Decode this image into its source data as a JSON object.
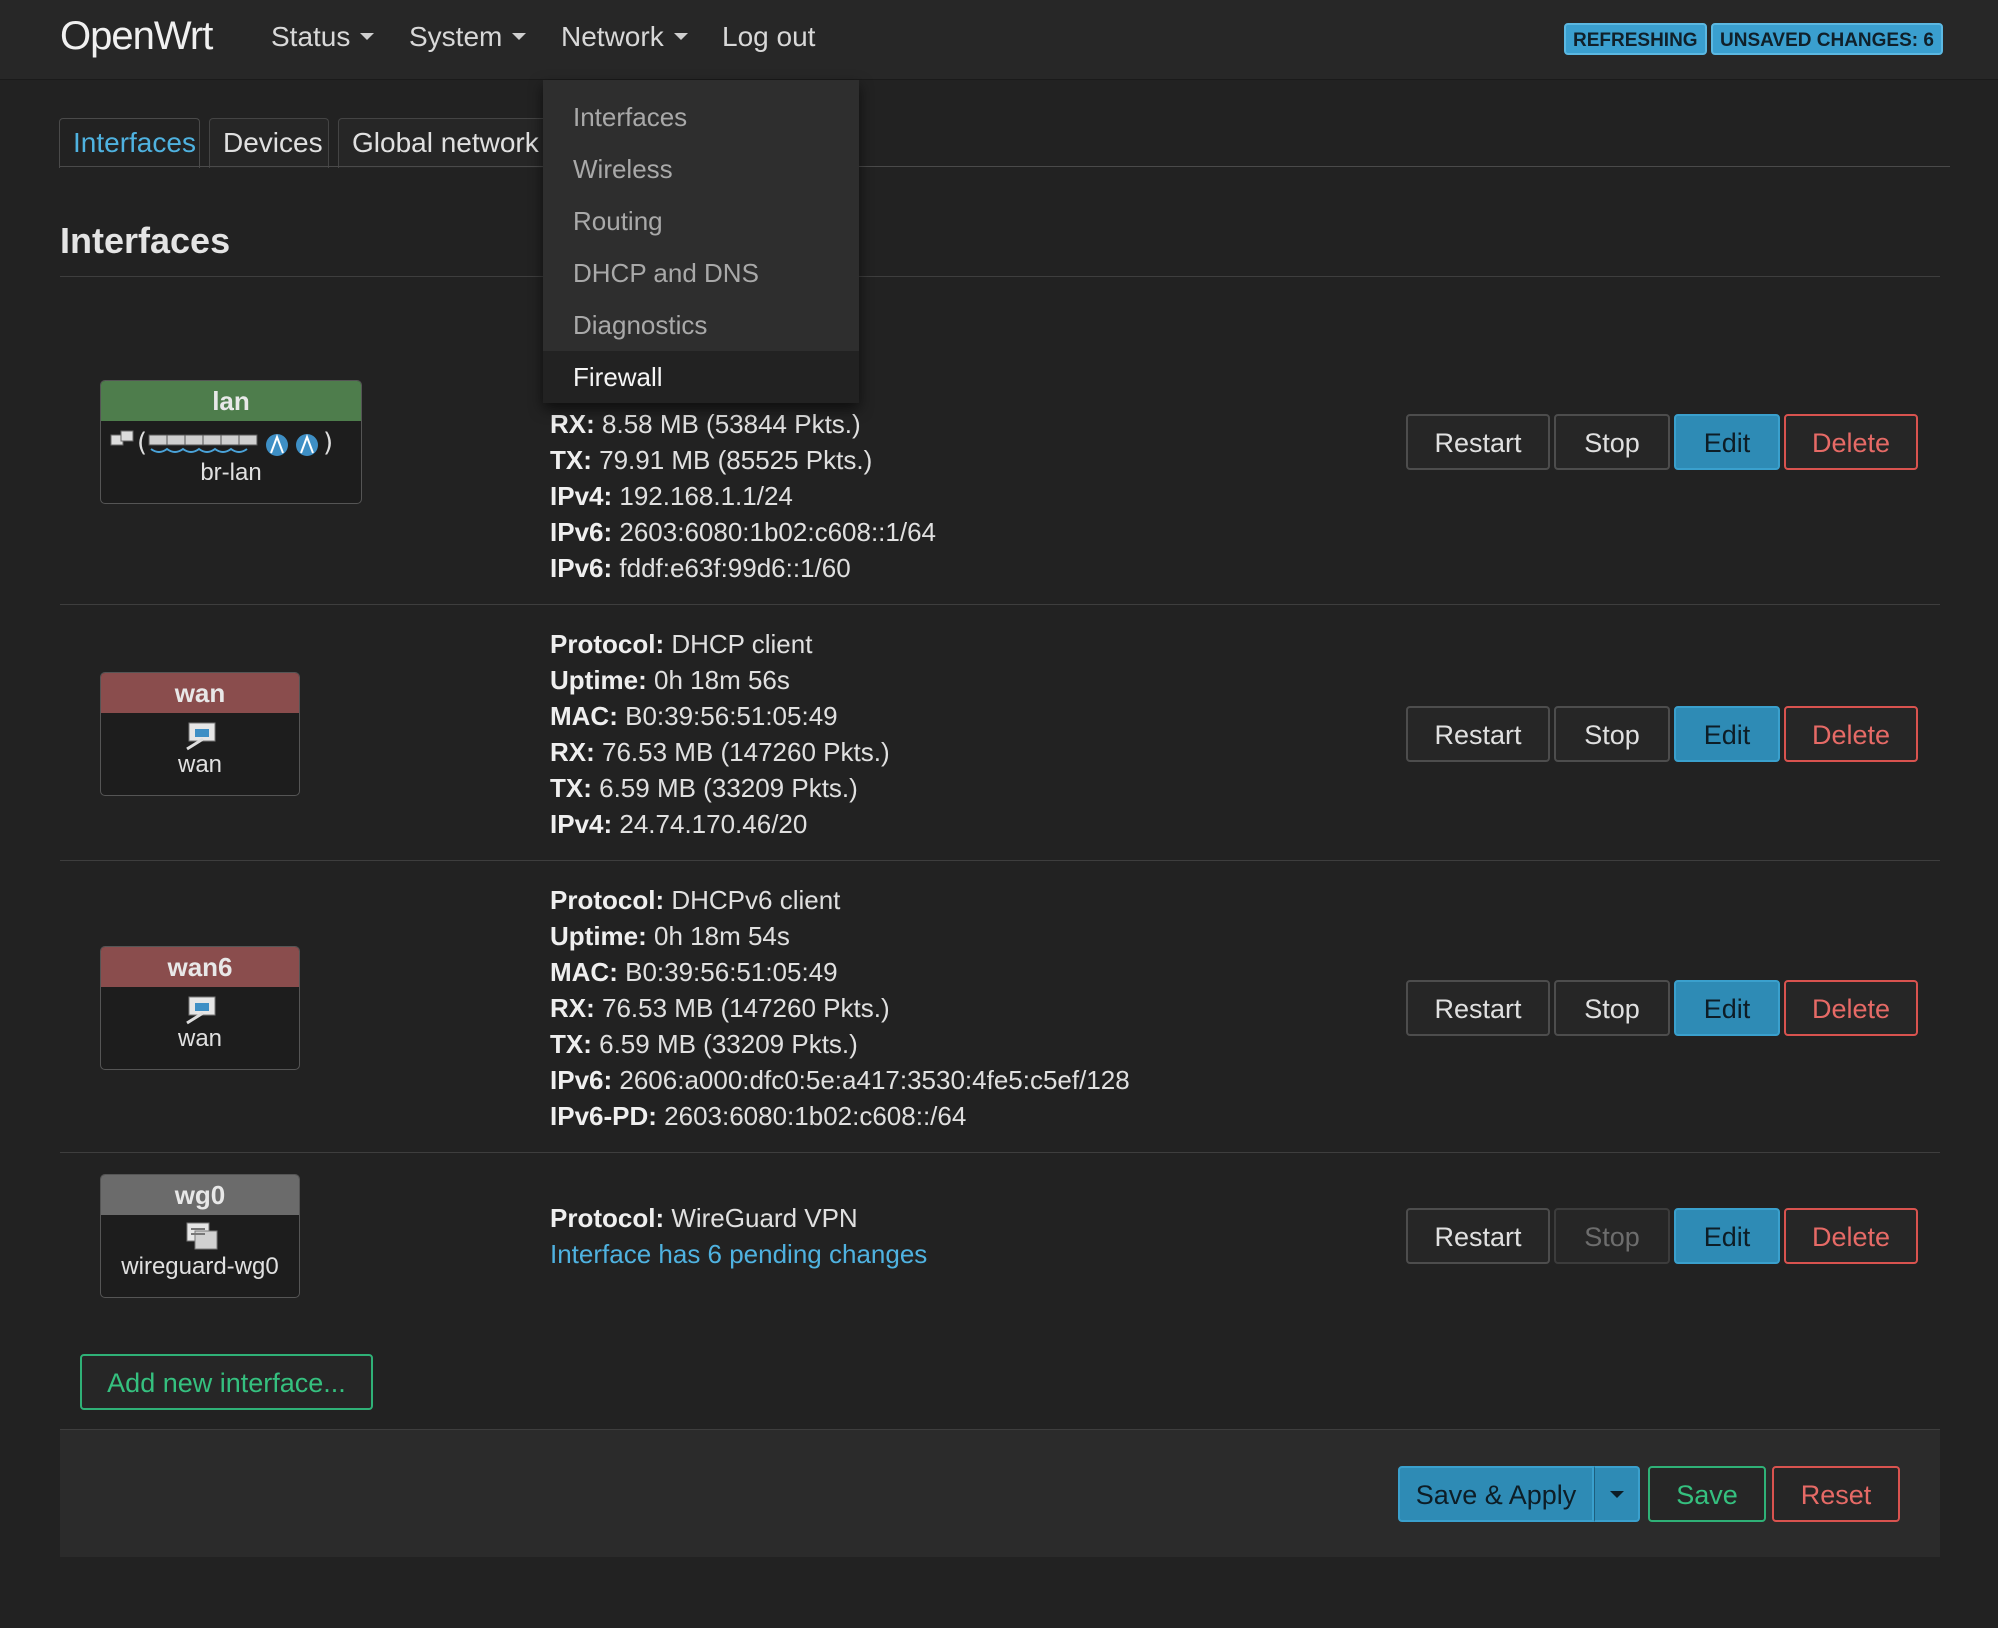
{
  "header": {
    "brand": "OpenWrt",
    "menu": [
      {
        "label": "Status",
        "has_caret": true
      },
      {
        "label": "System",
        "has_caret": true
      },
      {
        "label": "Network",
        "has_caret": true
      },
      {
        "label": "Log out",
        "has_caret": false
      }
    ],
    "badges": {
      "refreshing": "REFRESHING",
      "unsaved": "UNSAVED CHANGES: 6"
    }
  },
  "tabs": [
    {
      "label": "Interfaces",
      "active": true
    },
    {
      "label": "Devices",
      "active": false
    },
    {
      "label": "Global network o",
      "active": false
    }
  ],
  "network_menu": {
    "items": [
      "Interfaces",
      "Wireless",
      "Routing",
      "DHCP and DNS",
      "Diagnostics",
      "Firewall"
    ],
    "hovered": "Firewall"
  },
  "section_title": "Interfaces",
  "interfaces": [
    {
      "name": "lan",
      "device": "br-lan",
      "header_color": "#4e7d4c",
      "info": [
        {
          "k": "RX:",
          "v": " 8.58 MB (53844 Pkts.)"
        },
        {
          "k": "TX:",
          "v": " 79.91 MB (85525 Pkts.)"
        },
        {
          "k": "IPv4:",
          "v": " 192.168.1.1/24"
        },
        {
          "k": "IPv6:",
          "v": " 2603:6080:1b02:c608::1/64"
        },
        {
          "k": "IPv6:",
          "v": " fddf:e63f:99d6::1/60"
        }
      ],
      "pending": ""
    },
    {
      "name": "wan",
      "device": "wan",
      "header_color": "#8a4d4d",
      "info": [
        {
          "k": "Protocol:",
          "v": " DHCP client"
        },
        {
          "k": "Uptime:",
          "v": " 0h 18m 56s"
        },
        {
          "k": "MAC:",
          "v": " B0:39:56:51:05:49"
        },
        {
          "k": "RX:",
          "v": " 76.53 MB (147260 Pkts.)"
        },
        {
          "k": "TX:",
          "v": " 6.59 MB (33209 Pkts.)"
        },
        {
          "k": "IPv4:",
          "v": " 24.74.170.46/20"
        }
      ],
      "pending": ""
    },
    {
      "name": "wan6",
      "device": "wan",
      "header_color": "#8a4d4d",
      "info": [
        {
          "k": "Protocol:",
          "v": " DHCPv6 client"
        },
        {
          "k": "Uptime:",
          "v": " 0h 18m 54s"
        },
        {
          "k": "MAC:",
          "v": " B0:39:56:51:05:49"
        },
        {
          "k": "RX:",
          "v": " 76.53 MB (147260 Pkts.)"
        },
        {
          "k": "TX:",
          "v": " 6.59 MB (33209 Pkts.)"
        },
        {
          "k": "IPv6:",
          "v": " 2606:a000:dfc0:5e:a417:3530:4fe5:c5ef/128"
        },
        {
          "k": "IPv6-PD:",
          "v": " 2603:6080:1b02:c608::/64"
        }
      ],
      "pending": ""
    },
    {
      "name": "wg0",
      "device": "wireguard-wg0",
      "header_color": "#6b6b6b",
      "info": [
        {
          "k": "Protocol:",
          "v": " WireGuard VPN"
        }
      ],
      "pending": "Interface has 6 pending changes"
    }
  ],
  "row_buttons": {
    "restart": "Restart",
    "stop": "Stop",
    "edit": "Edit",
    "delete": "Delete"
  },
  "wg0_stop_disabled": true,
  "add_interface": "Add new interface...",
  "footer": {
    "save_apply": "Save & Apply",
    "save": "Save",
    "reset": "Reset"
  }
}
